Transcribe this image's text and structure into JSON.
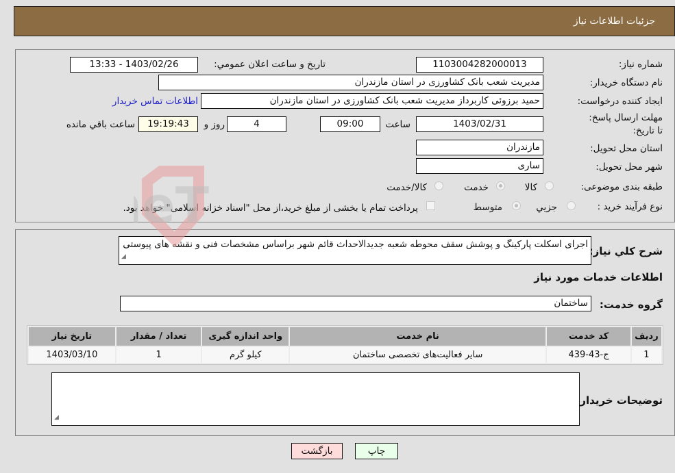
{
  "header": {
    "title": "جزئیات اطلاعات نیاز"
  },
  "fields": {
    "need_number": {
      "label": "شماره نیاز:",
      "value": "1103004282000013"
    },
    "announce_datetime": {
      "label": "تاریخ و ساعت اعلان عمومي:",
      "value": "1403/02/26 - 13:33"
    },
    "buyer_org": {
      "label": "نام دستگاه خریدار:",
      "value": "مدیریت شعب بانک کشاورزی در استان مازندران"
    },
    "requester": {
      "label": "ایجاد کننده درخواست:",
      "value": "حمید برزوئی کاربرداز مدیریت شعب بانک کشاورزی در استان مازندران"
    },
    "buyer_contact_link": "اطلاعات تماس خریدار",
    "deadline": {
      "label": "مهلت ارسال پاسخ: تا تاریخ:",
      "date": "1403/02/31",
      "time_label": "ساعت",
      "time": "09:00",
      "days": "4",
      "days_label": "روز و",
      "remaining": "19:19:43",
      "remaining_label": "ساعت باقي مانده"
    },
    "delivery_province": {
      "label": "استان محل تحویل:",
      "value": "مازندران"
    },
    "delivery_city": {
      "label": "شهر محل تحویل:",
      "value": "ساری"
    },
    "category": {
      "label": "طبقه بندی موضوعی:",
      "options": [
        "کالا",
        "خدمت",
        "کالا/خدمت"
      ],
      "selected": "خدمت"
    },
    "purchase_type": {
      "label": "نوع فرآیند خرید :",
      "options": [
        "جزیي",
        "متوسط"
      ],
      "selected": "متوسط",
      "treasury_note": "پرداخت تمام یا بخشی از مبلغ خرید،از محل \"اسناد خزانه اسلامی\" خواهد بود."
    }
  },
  "description": {
    "label": "شرح کلي نیاز:",
    "value": "اجرای اسکلت پارکینگ و پوشش سقف محوطه شعبه جدیدالاحداث قائم شهر براساس مشخصات فنی و نقشه های پیوستی"
  },
  "services": {
    "section_title": "اطلاعات خدمات مورد نیاز",
    "group_label": "گروه خدمت:",
    "group_value": "ساختمان",
    "columns": [
      "ردیف",
      "کد خدمت",
      "نام خدمت",
      "واحد اندازه گیری",
      "تعداد / مقدار",
      "تاریخ نیاز"
    ],
    "rows": [
      [
        "1",
        "ج-43-439",
        "سایر فعالیت‌های تخصصی ساختمان",
        "کیلو گرم",
        "1",
        "1403/03/10"
      ]
    ]
  },
  "buyer_notes": {
    "label": "توضیحات خریدار:",
    "value": ""
  },
  "buttons": {
    "print": "چاپ",
    "back": "بازگشت"
  },
  "colors": {
    "header_bg": "#8c6d43",
    "print_bg": "#eaffea",
    "back_bg": "#ffdcdc",
    "link": "#2020c8"
  },
  "watermark": "AriaTender.neT"
}
